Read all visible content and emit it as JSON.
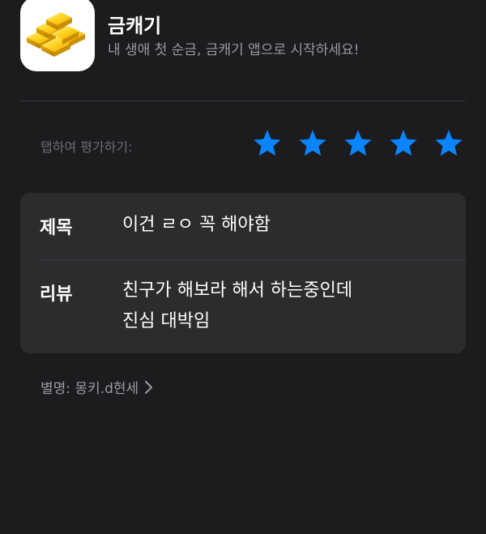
{
  "app": {
    "name": "금캐기",
    "subtitle": "내 생애 첫 순금, 금캐기 앱으로 시작하세요!",
    "icon": "gold-bars-icon"
  },
  "rating": {
    "label": "탭하여 평가하기:",
    "value": 5,
    "max": 5,
    "star_color": "#0a84ff"
  },
  "review": {
    "title_label": "제목",
    "title_value": "이건 ㄹㅇ 꼭 해야함",
    "body_label": "리뷰",
    "body_lines": [
      "친구가 해보라 해서 하는중인데",
      "진심 대박임"
    ]
  },
  "nickname": {
    "text": "별명: 몽키.d현세",
    "icon": "chevron-right-icon"
  },
  "colors": {
    "background": "#1c1c1e",
    "card": "#2c2c2e",
    "secondary_text": "#9a9aa0"
  }
}
